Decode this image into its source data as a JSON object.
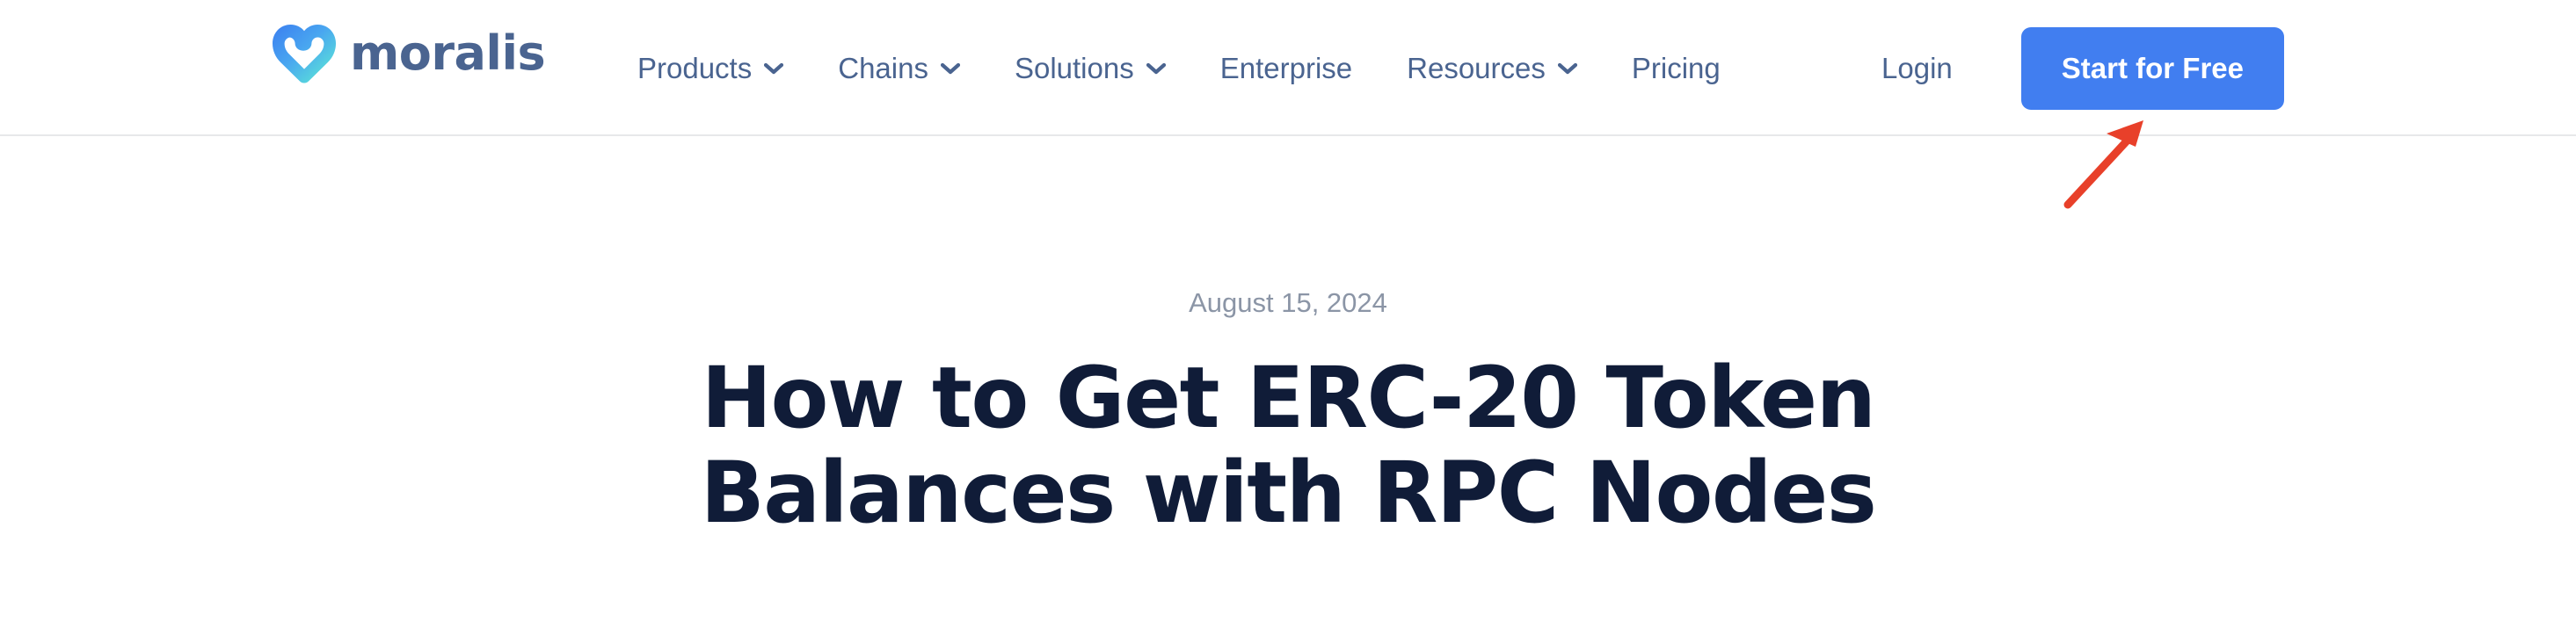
{
  "header": {
    "brand": {
      "name": "moralis",
      "logo_icon": "moralis-heart-logo",
      "gradient_start": "#3b7ef0",
      "gradient_end": "#6ff0c0"
    },
    "nav": [
      {
        "label": "Products",
        "has_dropdown": true,
        "icon": "chevron-down-icon"
      },
      {
        "label": "Chains",
        "has_dropdown": true,
        "icon": "chevron-down-icon"
      },
      {
        "label": "Solutions",
        "has_dropdown": true,
        "icon": "chevron-down-icon"
      },
      {
        "label": "Enterprise",
        "has_dropdown": false,
        "icon": ""
      },
      {
        "label": "Resources",
        "has_dropdown": true,
        "icon": "chevron-down-icon"
      },
      {
        "label": "Pricing",
        "has_dropdown": false,
        "icon": ""
      }
    ],
    "login_label": "Login",
    "cta_label": "Start for Free",
    "cta_color": "#417ef0",
    "nav_text_color": "#4a6490"
  },
  "annotation": {
    "type": "arrow",
    "color": "#e8402a",
    "points_to": "Start for Free"
  },
  "article": {
    "date": "August 15, 2024",
    "title": "How to Get ERC-20 Token Balances with RPC Nodes",
    "title_color": "#101c38",
    "date_color": "#8b95a6"
  }
}
